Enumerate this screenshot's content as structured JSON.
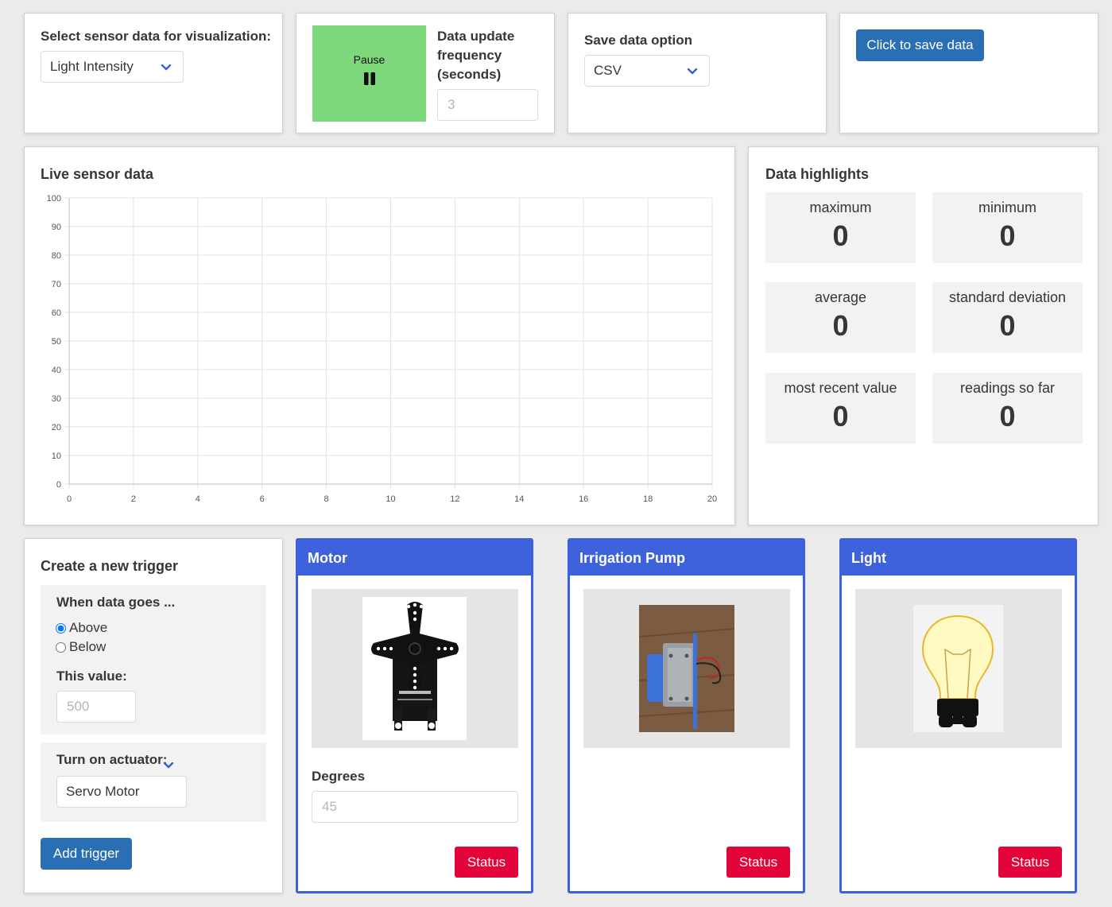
{
  "sensor_select": {
    "label": "Select sensor data for visualization:",
    "value": "Light Intensity"
  },
  "pause_control": {
    "label": "Pause",
    "color": "#7dd87b"
  },
  "frequency": {
    "label_line1": "Data update",
    "label_line2": "frequency",
    "label_line3": "(seconds)",
    "placeholder": "3"
  },
  "save_option": {
    "label": "Save data option",
    "value": "CSV"
  },
  "save_button": {
    "label": "Click to save data"
  },
  "live_chart": {
    "title": "Live sensor data",
    "chart_data": {
      "type": "line",
      "title": "Live sensor data",
      "xlabel": "",
      "ylabel": "",
      "x_ticks": [
        0,
        2,
        4,
        6,
        8,
        10,
        12,
        14,
        16,
        18,
        20
      ],
      "y_ticks": [
        0,
        10,
        20,
        30,
        40,
        50,
        60,
        70,
        80,
        90,
        100
      ],
      "xlim": [
        0,
        20
      ],
      "ylim": [
        0,
        100
      ],
      "grid": true,
      "series": []
    }
  },
  "highlights": {
    "title": "Data highlights",
    "items": [
      {
        "label": "maximum",
        "value": "0"
      },
      {
        "label": "minimum",
        "value": "0"
      },
      {
        "label": "average",
        "value": "0"
      },
      {
        "label": "standard deviation",
        "value": "0"
      },
      {
        "label": "most recent value",
        "value": "0"
      },
      {
        "label": "readings so far",
        "value": "0"
      }
    ]
  },
  "trigger": {
    "title": "Create a new trigger",
    "when_label": "When data goes ...",
    "option_above": "Above",
    "option_below": "Below",
    "selected": "Above",
    "value_label": "This value:",
    "value_placeholder": "500",
    "actuator_label": "Turn on actuator:",
    "actuator_value": "Servo Motor",
    "add_button": "Add trigger"
  },
  "actuators": {
    "motor": {
      "title": "Motor",
      "degrees_label": "Degrees",
      "degrees_placeholder": "45",
      "status": "Status",
      "image_icon": "servo-motor-image"
    },
    "pump": {
      "title": "Irrigation Pump",
      "status": "Status",
      "image_icon": "irrigation-pump-image"
    },
    "light": {
      "title": "Light",
      "status": "Status",
      "image_icon": "light-bulb-image"
    }
  },
  "colors": {
    "accent_blue": "#2a6fb3",
    "card_header_blue": "#3d62dc",
    "status_red": "#e3053a"
  }
}
